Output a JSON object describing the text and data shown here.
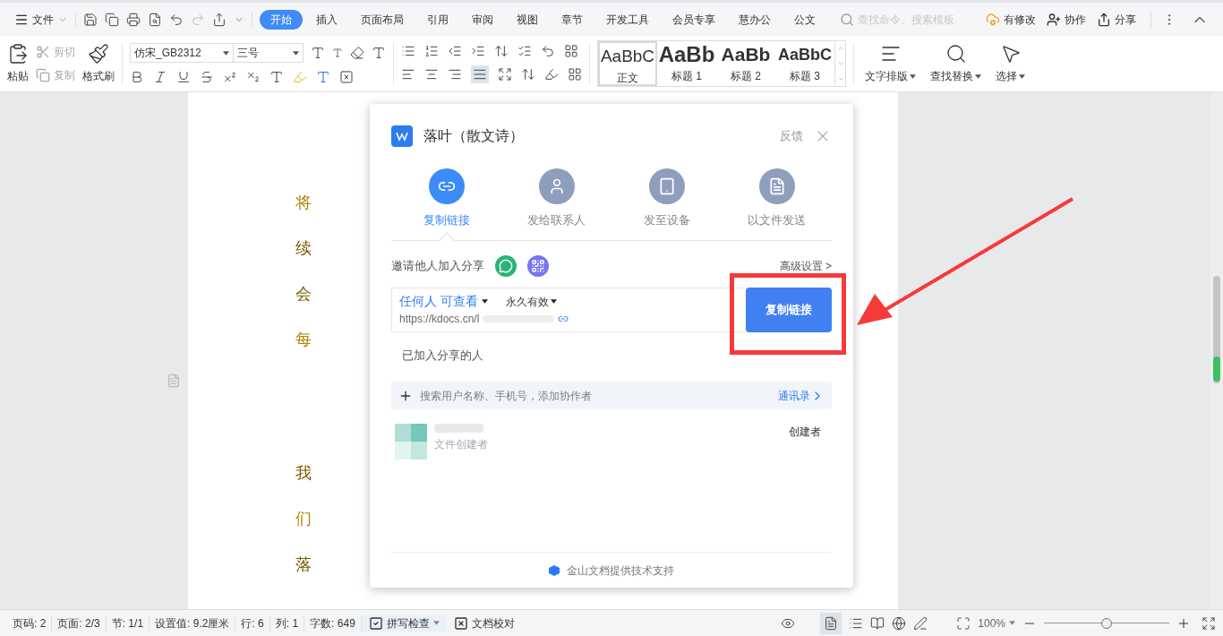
{
  "menu": {
    "file": "文件",
    "tabs": [
      {
        "label": "开始",
        "selected": true
      },
      {
        "label": "插入",
        "selected": false
      },
      {
        "label": "页面布局",
        "selected": false
      },
      {
        "label": "引用",
        "selected": false
      },
      {
        "label": "审阅",
        "selected": false
      },
      {
        "label": "视图",
        "selected": false
      },
      {
        "label": "章节",
        "selected": false
      },
      {
        "label": "开发工具",
        "selected": false
      },
      {
        "label": "会员专享",
        "selected": false
      },
      {
        "label": "慧办公",
        "selected": false
      },
      {
        "label": "公文",
        "selected": false
      }
    ],
    "search": {
      "placeholder": "查找命令、搜索模板"
    },
    "actions": [
      "有修改",
      "协作",
      "分享"
    ]
  },
  "ribbon": {
    "paste": "粘贴",
    "cut": {
      "label": "剪切",
      "disabled": true
    },
    "copy": {
      "label": "复制",
      "disabled": true
    },
    "format_painter": "格式刷",
    "font": "仿宋_GB2312",
    "size": "三号",
    "styles": [
      {
        "preview": "AaBbC",
        "label": "正文",
        "selected": true,
        "kind": "normal"
      },
      {
        "preview": "AaBb",
        "label": "标题 1",
        "selected": false,
        "kind": "h1"
      },
      {
        "preview": "AaBb",
        "label": "标题 2",
        "selected": false,
        "kind": "h2"
      },
      {
        "preview": "AaBbC",
        "label": "标题 3",
        "selected": false,
        "kind": "h3"
      }
    ],
    "big_buttons": [
      {
        "label": "文字排版",
        "kind": "layout"
      },
      {
        "label": "查找替换",
        "kind": "find"
      },
      {
        "label": "选择",
        "kind": "select"
      }
    ]
  },
  "document": {
    "line_starts": [
      "将",
      "续",
      "会",
      "每",
      "我",
      "们",
      "落"
    ]
  },
  "dialog": {
    "title": "落叶（散文诗）",
    "feedback": "反馈",
    "options": [
      {
        "label": "复制链接",
        "kind": "link",
        "selected": true
      },
      {
        "label": "发给联系人",
        "kind": "contact",
        "selected": false
      },
      {
        "label": "发至设备",
        "kind": "device",
        "selected": false
      },
      {
        "label": "以文件发送",
        "kind": "file",
        "selected": false
      }
    ],
    "invite": "邀请他人加入分享",
    "advanced": "高级设置 >",
    "permission": "任何人 可查看",
    "validity": "永久有效",
    "url": "https://kdocs.cn/l",
    "copy_button": "复制链接",
    "joined": "已加入分享的人",
    "search": {
      "placeholder": "搜索用户名称、手机号，添加协作者"
    },
    "contacts": "通讯录",
    "members": [
      {
        "subtitle": "文件创建者",
        "role": "创建者"
      }
    ],
    "footer": "金山文档提供技术支持"
  },
  "status_bar": {
    "items": [
      "页码: 2",
      "页面: 2/3",
      "节: 1/1",
      "设置值: 9.2厘米",
      "行: 6",
      "列: 1",
      "字数: 649"
    ],
    "spell": "拼写检查",
    "proof": "文档校对",
    "zoom": "100%",
    "zoom_slider": {
      "level": 0.5
    }
  }
}
